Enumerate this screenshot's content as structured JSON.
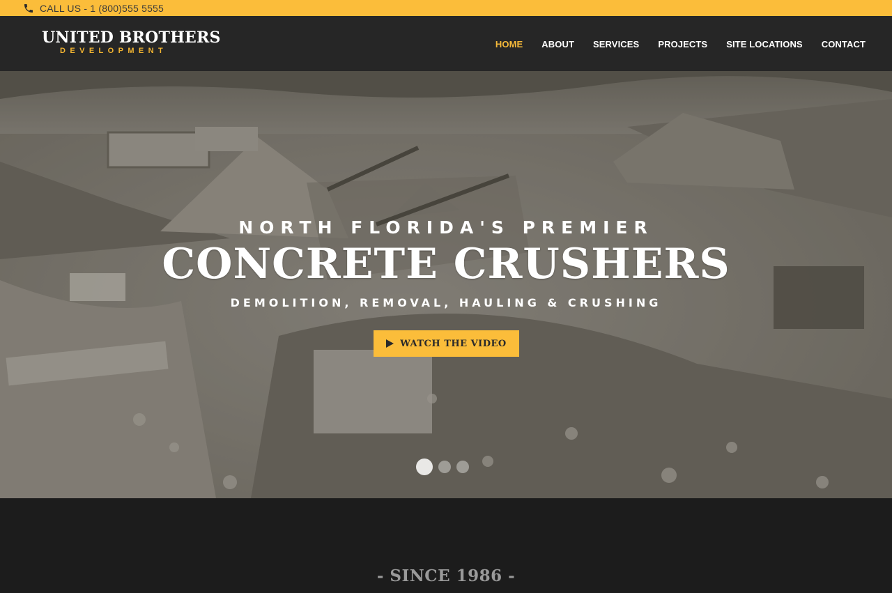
{
  "topbar": {
    "phone_icon": "phone-icon",
    "phone_text": "CALL US - 1 (800)555 5555"
  },
  "brand": {
    "name": "UNITED BROTHERS",
    "tagline": "DEVELOPMENT"
  },
  "nav": {
    "items": [
      {
        "label": "HOME",
        "active": true
      },
      {
        "label": "ABOUT",
        "active": false
      },
      {
        "label": "SERVICES",
        "active": false
      },
      {
        "label": "PROJECTS",
        "active": false
      },
      {
        "label": "SITE LOCATIONS",
        "active": false
      },
      {
        "label": "CONTACT",
        "active": false
      }
    ]
  },
  "hero": {
    "kicker": "NORTH FLORIDA'S PREMIER",
    "title": "CONCRETE CRUSHERS",
    "subtitle": "DEMOLITION, REMOVAL, HAULING & CRUSHING",
    "button_label": "WATCH THE VIDEO",
    "button_icon": "play-icon",
    "slides_count": 3,
    "active_slide": 1
  },
  "section": {
    "since": "- SINCE 1986 -"
  },
  "colors": {
    "accent": "#fbbd3a",
    "header_bg": "#262626",
    "footer_bg": "#1c1c1c"
  }
}
